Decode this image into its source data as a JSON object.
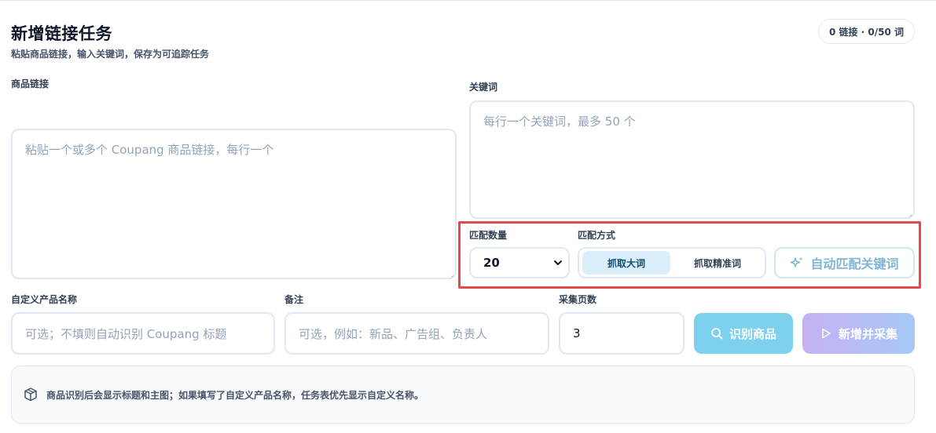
{
  "header": {
    "title": "新增链接任务",
    "subtitle": "粘贴商品链接，输入关键词，保存为可追踪任务",
    "counter": "0 链接 · 0/50 词"
  },
  "links": {
    "label": "商品链接",
    "placeholder": "粘贴一个或多个 Coupang 商品链接，每行一个"
  },
  "keywords": {
    "label": "关键词",
    "placeholder": "每行一个关键词，最多 50 个"
  },
  "match": {
    "count_label": "匹配数量",
    "count_value": "20",
    "mode_label": "匹配方式",
    "modes": [
      {
        "label": "抓取大词",
        "active": true
      },
      {
        "label": "抓取精准词",
        "active": false
      }
    ],
    "auto_button": "自动匹配关键词",
    "highlight_color": "#e5484d"
  },
  "custom_name": {
    "label": "自定义产品名称",
    "placeholder": "可选；不填则自动识别 Coupang 标题"
  },
  "note": {
    "label": "备注",
    "placeholder": "可选，例如：新品、广告组、负责人"
  },
  "pages": {
    "label": "采集页数",
    "value": "3"
  },
  "actions": {
    "identify": "识别商品",
    "create": "新增并采集"
  },
  "info": {
    "text": "商品识别后会显示标题和主图；如果填写了自定义产品名称，任务表优先显示自定义名称。"
  },
  "icons": {
    "search": "search-icon",
    "play": "play-icon",
    "sparkle": "sparkle-icon",
    "box": "box-icon",
    "chevron": "chevron-down-icon"
  }
}
